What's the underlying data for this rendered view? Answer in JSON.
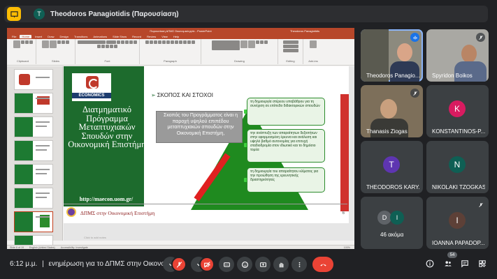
{
  "banner": {
    "avatar_letter": "T",
    "presenter": "Theodoros Panagiotidis (Παρουσίαση)"
  },
  "ppt": {
    "window_title": "Παρουσίαση ΔΠΜΣ Οικονομικά.pptx - PowerPoint",
    "user": "Theodoros Panagiotidis",
    "tabs": [
      "File",
      "Home",
      "Insert",
      "Draw",
      "Design",
      "Transitions",
      "Animations",
      "Slide Show",
      "Record",
      "Review",
      "View",
      "Help"
    ],
    "ribbon_groups": [
      "Clipboard",
      "Slides",
      "Font",
      "Paragraph",
      "Drawing",
      "Editing",
      "Add-ins"
    ],
    "notes_placeholder": "Click to add notes",
    "status": [
      "Slide 6 of 19",
      "English (United States)",
      "Accessibility: Investigate"
    ],
    "zoom": "100%"
  },
  "slide": {
    "logo_text": "ECONOMICS",
    "program_title": "Διατμηματικό Πρόγραμμα Μεταπτυχιακών Σπουδών στην Οικονομική Επιστήμη",
    "website": "http://maecon.uom.gr/",
    "heading": "ΣΚΟΠΟΣ ΚΑΙ ΣΤΟΧΟΙ",
    "aim": "Σκοπός του Προγράμματος είναι η παροχή υψηλού επιπέδου μεταπτυχιακών σπουδών στην Οικονομική Επιστήμη,",
    "goals": [
      "τη δημιουργία στέρεου υποβάθρου για τη συνέχιση σε επίπεδο διδακτορικών σπουδών",
      "την ανάπτυξη των απαραίτητων δεξιοτήτων στην εφαρμοσμένη έρευνα και ανάλυση και υψηλό βαθμό αυτονομίας για επιτυχή σταδιοδρομία στον ιδιωτικό και το δημόσιο τομέα",
      "τη δημιουργία του απαραίτητου κλίματος για την προώθηση της ερευνητικής δραστηριότητας"
    ],
    "footer": "ΔΠΜΣ στην Οικονομική Επιστήμη",
    "page_number": "6"
  },
  "participants": [
    {
      "name": "Theodoros Panagio...",
      "type": "video"
    },
    {
      "name": "Spyridon Boikos",
      "type": "video"
    },
    {
      "name": "Thanasis Ziogas",
      "type": "video"
    },
    {
      "name": "KONSTANTINOS-P...",
      "letter": "K",
      "color": "#d81b60"
    },
    {
      "name": "THEODOROS KARY...",
      "letter": "T",
      "color": "#5e35b1"
    },
    {
      "name": "NIKOLAKI TZOGKAS",
      "letter": "N",
      "color": "#0f5f54"
    },
    {
      "name": "46 ακόμα",
      "letters": [
        "D",
        "I"
      ],
      "colors": [
        "#5f6368",
        "#0f5f54"
      ]
    },
    {
      "name": "IOANNA PAPADOP...",
      "letter": "I",
      "color": "#5d4037"
    }
  ],
  "bottom": {
    "time": "6:12 μ.μ.",
    "separator": "|",
    "meeting": "ενημέρωση για το ΔΠΜΣ στην Οικονομι...",
    "participant_count": "54"
  },
  "colors": {
    "meet_bg": "#202124",
    "tile_bg": "#3c4043",
    "danger": "#ea4335",
    "slide_green": "#1d6b2d",
    "ppt_accent": "#b7472a"
  }
}
